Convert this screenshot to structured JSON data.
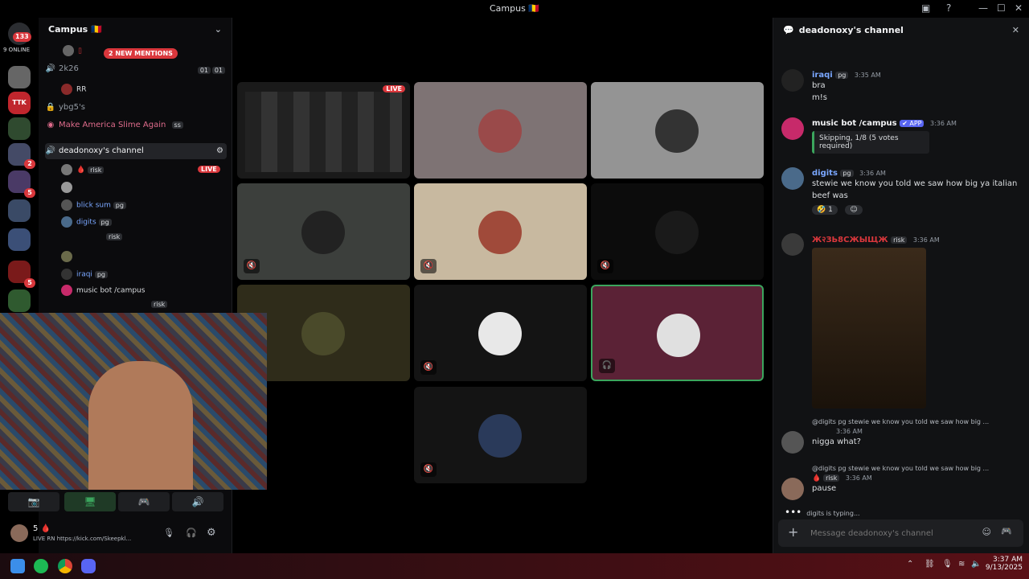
{
  "window": {
    "title": "Campus 🇹🇩",
    "minimize": "—",
    "maximize": "☐",
    "close": "✕"
  },
  "guilds": {
    "dm_badge": "133",
    "online": "9 ONLINE",
    "server_label": "TTK",
    "badges": [
      "2",
      "5",
      "5"
    ]
  },
  "server": {
    "name": "Campus 🇹🇩",
    "mentions": "2 NEW MENTIONS",
    "channels": [
      {
        "name": "2k26",
        "counter_a": "01",
        "counter_b": "01"
      },
      {
        "name": "ybg5's"
      },
      {
        "name": "Make America Slime Again"
      },
      {
        "name": "deadonoxy's channel"
      }
    ],
    "users": [
      {
        "name": "RR"
      },
      {
        "name": "ss"
      },
      {
        "name": "risk",
        "live": "LIVE"
      },
      {
        "name": "blick sum",
        "tag": "pg"
      },
      {
        "name": "digits",
        "tag": "pg"
      },
      {
        "name": "risk"
      },
      {
        "name": "iraqi",
        "tag": "pg"
      },
      {
        "name": "music bot /campus"
      },
      {
        "name": "risk"
      }
    ]
  },
  "stage": {
    "live_label": "LIVE"
  },
  "controls": {
    "camera": "📷",
    "share": "🖥",
    "activity": "🎮",
    "soundboard": "🔊"
  },
  "userbar": {
    "name": "5 🩸",
    "status": "LIVE RN https://kick.com/Skeepkl..."
  },
  "panel": {
    "title": "deadonoxy's channel",
    "messages": [
      {
        "name": "iraqi",
        "tag": "pg",
        "time": "3:35 AM",
        "lines": [
          "bra",
          "m!s"
        ]
      },
      {
        "name": "music bot /campus",
        "tag": "✔ APP",
        "time": "3:36 AM",
        "embed": "Skipping, 1/8 (5 votes required)"
      },
      {
        "name": "digits",
        "tag": "pg",
        "time": "3:36 AM",
        "lines": [
          "stewie we know you told we saw how big ya italian",
          "beef was"
        ],
        "reaction_count": "1"
      },
      {
        "name": "Ж२ЗЬ8СЖЫЩЖ",
        "tag": "risk",
        "time": "3:36 AM"
      },
      {
        "reply": "@digits  pg  stewie we know you told we saw how big ...",
        "time": "3:36 AM",
        "lines": [
          "nigga what?"
        ]
      },
      {
        "reply": "@digits  pg  stewie we know you told we saw how big ...",
        "name": "risk",
        "time": "3:36 AM",
        "lines": [
          "pause"
        ]
      }
    ],
    "typing": "digits is typing...",
    "input_placeholder": "Message deadonoxy's channel"
  },
  "taskbar": {
    "time": "3:37 AM",
    "date": "9/13/2025"
  }
}
